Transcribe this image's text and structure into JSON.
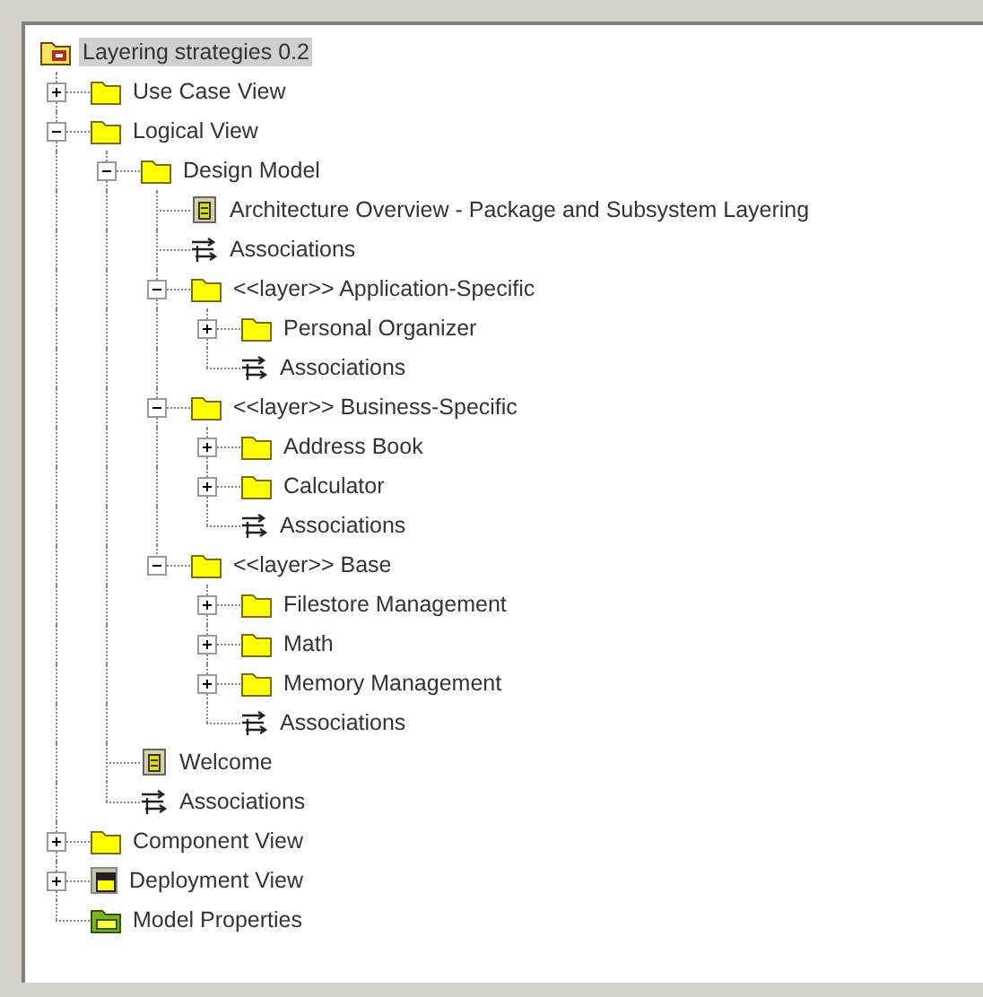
{
  "tree": {
    "label": "Layering strategies 0.2",
    "kind": "model",
    "selected": true,
    "children": [
      {
        "label": "Use Case View",
        "kind": "folder",
        "selected": false,
        "expanded": false
      },
      {
        "label": "Logical View",
        "kind": "folder",
        "selected": false,
        "expanded": true,
        "children": [
          {
            "label": "Design Model",
            "kind": "folder",
            "selected": false,
            "expanded": true,
            "children": [
              {
                "label": "Architecture Overview - Package and Subsystem Layering",
                "kind": "diagram",
                "selected": false
              },
              {
                "label": "Associations",
                "kind": "associations",
                "selected": false
              },
              {
                "label": "<<layer>> Application-Specific",
                "kind": "folder",
                "selected": false,
                "expanded": true,
                "children": [
                  {
                    "label": "Personal Organizer",
                    "kind": "folder",
                    "selected": false,
                    "expanded": false
                  },
                  {
                    "label": "Associations",
                    "kind": "associations",
                    "selected": false
                  }
                ]
              },
              {
                "label": "<<layer>> Business-Specific",
                "kind": "folder",
                "selected": false,
                "expanded": true,
                "children": [
                  {
                    "label": "Address Book",
                    "kind": "folder",
                    "selected": false,
                    "expanded": false
                  },
                  {
                    "label": "Calculator",
                    "kind": "folder",
                    "selected": false,
                    "expanded": false
                  },
                  {
                    "label": "Associations",
                    "kind": "associations",
                    "selected": false
                  }
                ]
              },
              {
                "label": "<<layer>> Base",
                "kind": "folder",
                "selected": false,
                "expanded": true,
                "children": [
                  {
                    "label": "Filestore Management",
                    "kind": "folder",
                    "selected": false,
                    "expanded": false
                  },
                  {
                    "label": "Math",
                    "kind": "folder",
                    "selected": false,
                    "expanded": false
                  },
                  {
                    "label": "Memory Management",
                    "kind": "folder",
                    "selected": false,
                    "expanded": false
                  },
                  {
                    "label": "Associations",
                    "kind": "associations",
                    "selected": false
                  }
                ]
              }
            ]
          },
          {
            "label": "Welcome",
            "kind": "diagram",
            "selected": false
          },
          {
            "label": "Associations",
            "kind": "associations",
            "selected": false
          }
        ]
      },
      {
        "label": "Component View",
        "kind": "folder",
        "selected": false,
        "expanded": false
      },
      {
        "label": "Deployment View",
        "kind": "deployment",
        "selected": false,
        "expanded": false
      },
      {
        "label": "Model Properties",
        "kind": "properties",
        "selected": false
      }
    ]
  }
}
